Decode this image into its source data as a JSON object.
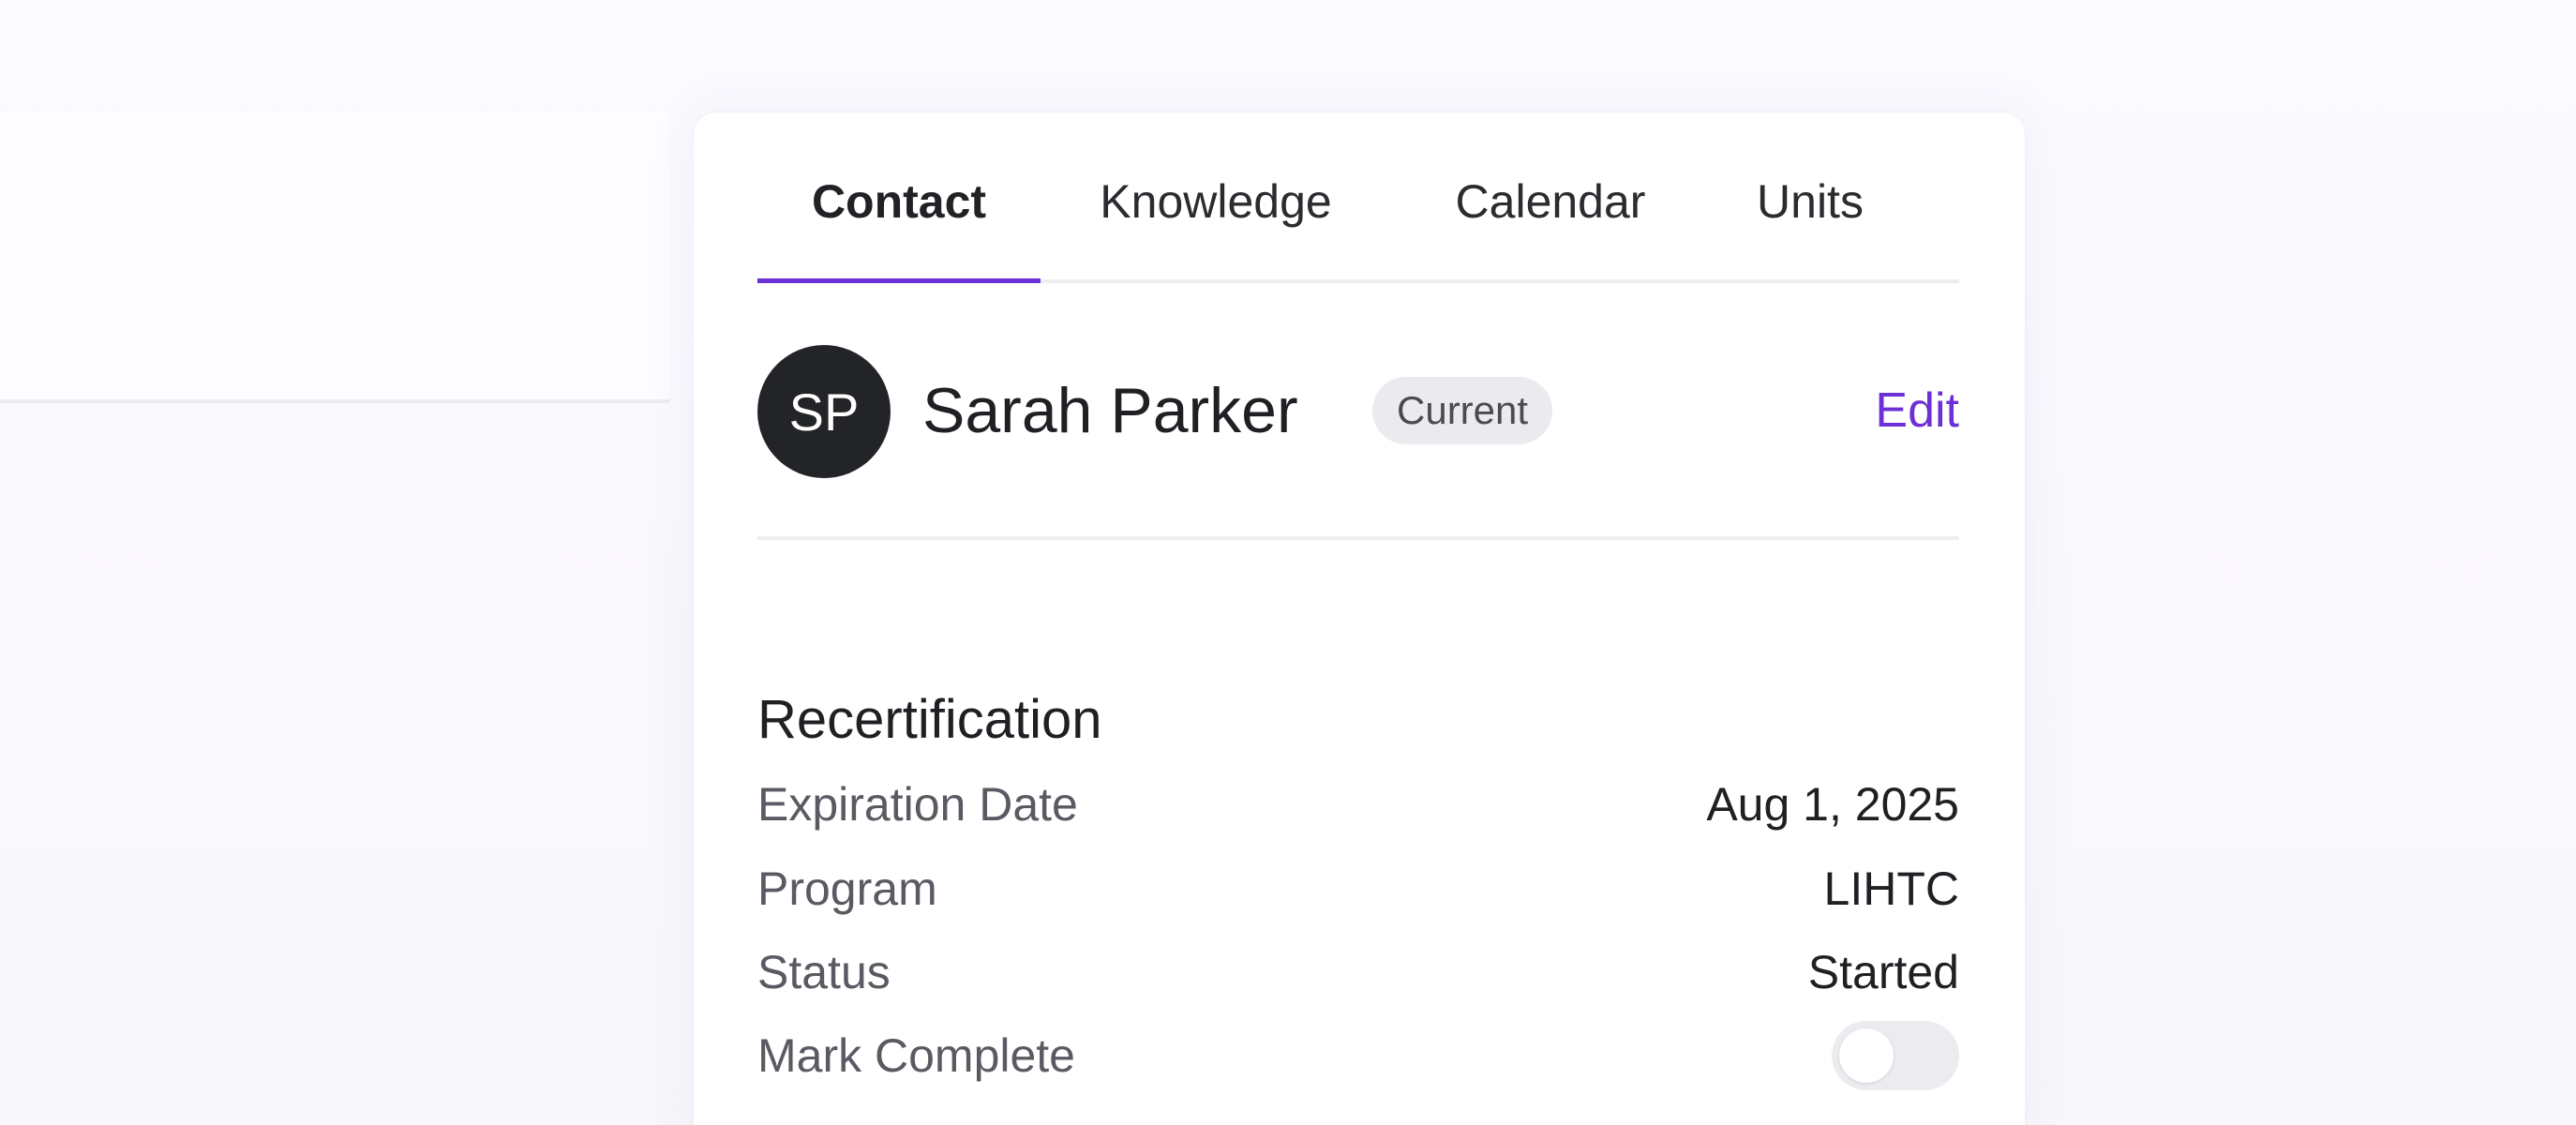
{
  "tabs": [
    {
      "label": "Contact",
      "active": true
    },
    {
      "label": "Knowledge",
      "active": false
    },
    {
      "label": "Calendar",
      "active": false
    },
    {
      "label": "Units",
      "active": false
    }
  ],
  "contact": {
    "initials": "SP",
    "name": "Sarah Parker",
    "status": "Current",
    "edit_label": "Edit"
  },
  "recertification": {
    "title": "Recertification",
    "rows": [
      {
        "label": "Expiration Date",
        "value": "Aug 1, 2025"
      },
      {
        "label": "Program",
        "value": "LIHTC"
      },
      {
        "label": "Status",
        "value": "Started"
      }
    ],
    "mark_complete": {
      "label": "Mark Complete",
      "checked": false
    }
  },
  "colors": {
    "accent": "#6d2fd6",
    "avatar_bg": "#232428",
    "badge_bg": "#ebebef"
  }
}
